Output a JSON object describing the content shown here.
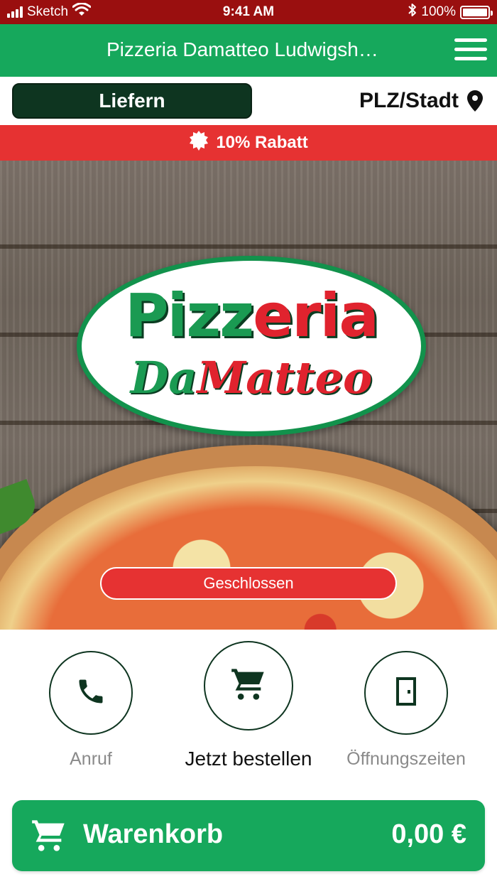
{
  "status_bar": {
    "carrier": "Sketch",
    "time": "9:41 AM",
    "battery": "100%"
  },
  "header": {
    "title": "Pizzeria Damatteo Ludwigshafen"
  },
  "delivery": {
    "mode_label": "Liefern",
    "location_label": "PLZ/Stadt"
  },
  "promo": {
    "text": "10% Rabatt"
  },
  "hero": {
    "logo_line1_a": "Pizz",
    "logo_line1_b": "eria",
    "logo_line2_a": "Da",
    "logo_line2_b": "Matteo",
    "status_badge": "Geschlossen"
  },
  "actions": {
    "call_label": "Anruf",
    "order_label": "Jetzt bestellen",
    "hours_label": "Öffnungszeiten"
  },
  "cart": {
    "label": "Warenkorb",
    "total": "0,00 €"
  },
  "colors": {
    "primary_green": "#16a85c",
    "dark_green": "#0e3520",
    "accent_red": "#e63232",
    "status_bar_red": "#9a0f0f"
  },
  "icons": [
    "signal-icon",
    "wifi-icon",
    "bluetooth-icon",
    "battery-icon",
    "hamburger-menu-icon",
    "location-pin-icon",
    "badge-icon",
    "phone-icon",
    "cart-icon",
    "door-icon"
  ]
}
